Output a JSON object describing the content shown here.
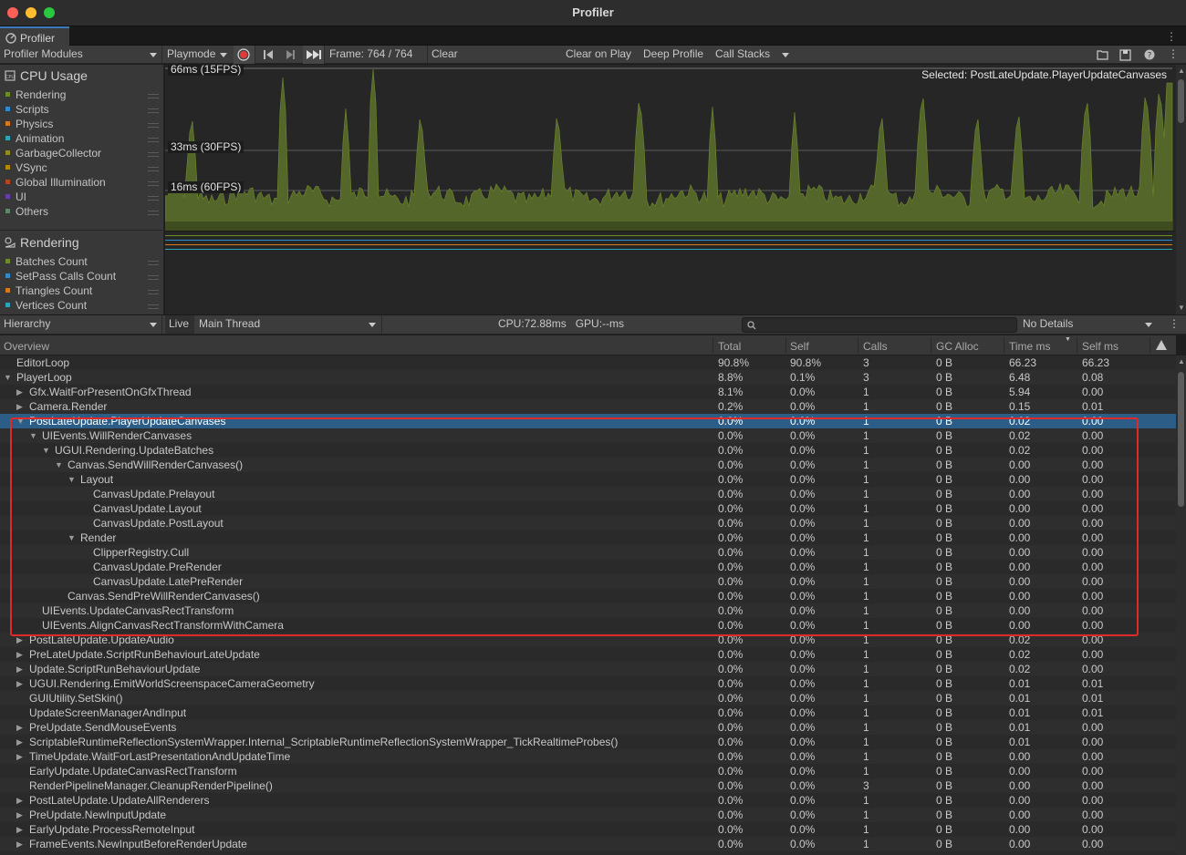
{
  "window": {
    "title": "Profiler"
  },
  "tab": {
    "label": "Profiler"
  },
  "toolbar": {
    "modules_label": "Profiler Modules",
    "playmode_label": "Playmode",
    "frame_label": "Frame: 764 / 764",
    "clear_label": "Clear",
    "clear_on_play_label": "Clear on Play",
    "deep_profile_label": "Deep Profile",
    "call_stacks_label": "Call Stacks"
  },
  "cpu_module": {
    "title": "CPU Usage",
    "legend": [
      {
        "label": "Rendering",
        "color": "#6b8e23"
      },
      {
        "label": "Scripts",
        "color": "#2e8bd0"
      },
      {
        "label": "Physics",
        "color": "#d87a1a"
      },
      {
        "label": "Animation",
        "color": "#2aa6b8"
      },
      {
        "label": "GarbageCollector",
        "color": "#9a8a1c"
      },
      {
        "label": "VSync",
        "color": "#b48a00"
      },
      {
        "label": "Global Illumination",
        "color": "#b8431f"
      },
      {
        "label": "UI",
        "color": "#6a3ca8"
      },
      {
        "label": "Others",
        "color": "#5a8a6a"
      }
    ]
  },
  "rendering_module": {
    "title": "Rendering",
    "legend": [
      {
        "label": "Batches Count",
        "color": "#6b8e23"
      },
      {
        "label": "SetPass Calls Count",
        "color": "#2e8bd0"
      },
      {
        "label": "Triangles Count",
        "color": "#d87a1a"
      },
      {
        "label": "Vertices Count",
        "color": "#2aa6b8"
      }
    ]
  },
  "chart": {
    "fps_66": "66ms (15FPS)",
    "fps_33": "33ms (30FPS)",
    "fps_16": "16ms (60FPS)",
    "selected": "Selected: PostLateUpdate.PlayerUpdateCanvases"
  },
  "hierarchy_toolbar": {
    "view_label": "Hierarchy",
    "live_label": "Live",
    "thread_label": "Main Thread",
    "stats": "CPU:72.88ms   GPU:--ms",
    "details_label": "No Details"
  },
  "table": {
    "headers": [
      "Overview",
      "Total",
      "Self",
      "Calls",
      "GC Alloc",
      "Time ms",
      "Self ms"
    ],
    "rows": [
      {
        "name": "EditorLoop",
        "indent": 0,
        "toggle": "",
        "total": "90.8%",
        "self": "90.8%",
        "calls": "3",
        "gc": "0 B",
        "time": "66.23",
        "selfms": "66.23"
      },
      {
        "name": "PlayerLoop",
        "indent": 0,
        "toggle": "▼",
        "total": "8.8%",
        "self": "0.1%",
        "calls": "3",
        "gc": "0 B",
        "time": "6.48",
        "selfms": "0.08"
      },
      {
        "name": "Gfx.WaitForPresentOnGfxThread",
        "indent": 1,
        "toggle": "▶",
        "total": "8.1%",
        "self": "0.0%",
        "calls": "1",
        "gc": "0 B",
        "time": "5.94",
        "selfms": "0.00"
      },
      {
        "name": "Camera.Render",
        "indent": 1,
        "toggle": "▶",
        "total": "0.2%",
        "self": "0.0%",
        "calls": "1",
        "gc": "0 B",
        "time": "0.15",
        "selfms": "0.01"
      },
      {
        "name": "PostLateUpdate.PlayerUpdateCanvases",
        "indent": 1,
        "toggle": "▼",
        "total": "0.0%",
        "self": "0.0%",
        "calls": "1",
        "gc": "0 B",
        "time": "0.02",
        "selfms": "0.00",
        "selected": true
      },
      {
        "name": "UIEvents.WillRenderCanvases",
        "indent": 2,
        "toggle": "▼",
        "total": "0.0%",
        "self": "0.0%",
        "calls": "1",
        "gc": "0 B",
        "time": "0.02",
        "selfms": "0.00"
      },
      {
        "name": "UGUI.Rendering.UpdateBatches",
        "indent": 3,
        "toggle": "▼",
        "total": "0.0%",
        "self": "0.0%",
        "calls": "1",
        "gc": "0 B",
        "time": "0.02",
        "selfms": "0.00"
      },
      {
        "name": "Canvas.SendWillRenderCanvases()",
        "indent": 4,
        "toggle": "▼",
        "total": "0.0%",
        "self": "0.0%",
        "calls": "1",
        "gc": "0 B",
        "time": "0.00",
        "selfms": "0.00"
      },
      {
        "name": "Layout",
        "indent": 5,
        "toggle": "▼",
        "total": "0.0%",
        "self": "0.0%",
        "calls": "1",
        "gc": "0 B",
        "time": "0.00",
        "selfms": "0.00"
      },
      {
        "name": "CanvasUpdate.Prelayout",
        "indent": 6,
        "toggle": "",
        "total": "0.0%",
        "self": "0.0%",
        "calls": "1",
        "gc": "0 B",
        "time": "0.00",
        "selfms": "0.00"
      },
      {
        "name": "CanvasUpdate.Layout",
        "indent": 6,
        "toggle": "",
        "total": "0.0%",
        "self": "0.0%",
        "calls": "1",
        "gc": "0 B",
        "time": "0.00",
        "selfms": "0.00"
      },
      {
        "name": "CanvasUpdate.PostLayout",
        "indent": 6,
        "toggle": "",
        "total": "0.0%",
        "self": "0.0%",
        "calls": "1",
        "gc": "0 B",
        "time": "0.00",
        "selfms": "0.00"
      },
      {
        "name": "Render",
        "indent": 5,
        "toggle": "▼",
        "total": "0.0%",
        "self": "0.0%",
        "calls": "1",
        "gc": "0 B",
        "time": "0.00",
        "selfms": "0.00"
      },
      {
        "name": "ClipperRegistry.Cull",
        "indent": 6,
        "toggle": "",
        "total": "0.0%",
        "self": "0.0%",
        "calls": "1",
        "gc": "0 B",
        "time": "0.00",
        "selfms": "0.00"
      },
      {
        "name": "CanvasUpdate.PreRender",
        "indent": 6,
        "toggle": "",
        "total": "0.0%",
        "self": "0.0%",
        "calls": "1",
        "gc": "0 B",
        "time": "0.00",
        "selfms": "0.00"
      },
      {
        "name": "CanvasUpdate.LatePreRender",
        "indent": 6,
        "toggle": "",
        "total": "0.0%",
        "self": "0.0%",
        "calls": "1",
        "gc": "0 B",
        "time": "0.00",
        "selfms": "0.00"
      },
      {
        "name": "Canvas.SendPreWillRenderCanvases()",
        "indent": 4,
        "toggle": "",
        "total": "0.0%",
        "self": "0.0%",
        "calls": "1",
        "gc": "0 B",
        "time": "0.00",
        "selfms": "0.00"
      },
      {
        "name": "UIEvents.UpdateCanvasRectTransform",
        "indent": 2,
        "toggle": "",
        "total": "0.0%",
        "self": "0.0%",
        "calls": "1",
        "gc": "0 B",
        "time": "0.00",
        "selfms": "0.00"
      },
      {
        "name": "UIEvents.AlignCanvasRectTransformWithCamera",
        "indent": 2,
        "toggle": "",
        "total": "0.0%",
        "self": "0.0%",
        "calls": "1",
        "gc": "0 B",
        "time": "0.00",
        "selfms": "0.00"
      },
      {
        "name": "PostLateUpdate.UpdateAudio",
        "indent": 1,
        "toggle": "▶",
        "total": "0.0%",
        "self": "0.0%",
        "calls": "1",
        "gc": "0 B",
        "time": "0.02",
        "selfms": "0.00"
      },
      {
        "name": "PreLateUpdate.ScriptRunBehaviourLateUpdate",
        "indent": 1,
        "toggle": "▶",
        "total": "0.0%",
        "self": "0.0%",
        "calls": "1",
        "gc": "0 B",
        "time": "0.02",
        "selfms": "0.00"
      },
      {
        "name": "Update.ScriptRunBehaviourUpdate",
        "indent": 1,
        "toggle": "▶",
        "total": "0.0%",
        "self": "0.0%",
        "calls": "1",
        "gc": "0 B",
        "time": "0.02",
        "selfms": "0.00"
      },
      {
        "name": "UGUI.Rendering.EmitWorldScreenspaceCameraGeometry",
        "indent": 1,
        "toggle": "▶",
        "total": "0.0%",
        "self": "0.0%",
        "calls": "1",
        "gc": "0 B",
        "time": "0.01",
        "selfms": "0.01"
      },
      {
        "name": "GUIUtility.SetSkin()",
        "indent": 1,
        "toggle": "",
        "total": "0.0%",
        "self": "0.0%",
        "calls": "1",
        "gc": "0 B",
        "time": "0.01",
        "selfms": "0.01"
      },
      {
        "name": "UpdateScreenManagerAndInput",
        "indent": 1,
        "toggle": "",
        "total": "0.0%",
        "self": "0.0%",
        "calls": "1",
        "gc": "0 B",
        "time": "0.01",
        "selfms": "0.01"
      },
      {
        "name": "PreUpdate.SendMouseEvents",
        "indent": 1,
        "toggle": "▶",
        "total": "0.0%",
        "self": "0.0%",
        "calls": "1",
        "gc": "0 B",
        "time": "0.01",
        "selfms": "0.00"
      },
      {
        "name": "ScriptableRuntimeReflectionSystemWrapper.Internal_ScriptableRuntimeReflectionSystemWrapper_TickRealtimeProbes()",
        "indent": 1,
        "toggle": "▶",
        "total": "0.0%",
        "self": "0.0%",
        "calls": "1",
        "gc": "0 B",
        "time": "0.01",
        "selfms": "0.00"
      },
      {
        "name": "TimeUpdate.WaitForLastPresentationAndUpdateTime",
        "indent": 1,
        "toggle": "▶",
        "total": "0.0%",
        "self": "0.0%",
        "calls": "1",
        "gc": "0 B",
        "time": "0.00",
        "selfms": "0.00"
      },
      {
        "name": "EarlyUpdate.UpdateCanvasRectTransform",
        "indent": 1,
        "toggle": "",
        "total": "0.0%",
        "self": "0.0%",
        "calls": "1",
        "gc": "0 B",
        "time": "0.00",
        "selfms": "0.00"
      },
      {
        "name": "RenderPipelineManager.CleanupRenderPipeline()",
        "indent": 1,
        "toggle": "",
        "total": "0.0%",
        "self": "0.0%",
        "calls": "3",
        "gc": "0 B",
        "time": "0.00",
        "selfms": "0.00"
      },
      {
        "name": "PostLateUpdate.UpdateAllRenderers",
        "indent": 1,
        "toggle": "▶",
        "total": "0.0%",
        "self": "0.0%",
        "calls": "1",
        "gc": "0 B",
        "time": "0.00",
        "selfms": "0.00"
      },
      {
        "name": "PreUpdate.NewInputUpdate",
        "indent": 1,
        "toggle": "▶",
        "total": "0.0%",
        "self": "0.0%",
        "calls": "1",
        "gc": "0 B",
        "time": "0.00",
        "selfms": "0.00"
      },
      {
        "name": "EarlyUpdate.ProcessRemoteInput",
        "indent": 1,
        "toggle": "▶",
        "total": "0.0%",
        "self": "0.0%",
        "calls": "1",
        "gc": "0 B",
        "time": "0.00",
        "selfms": "0.00"
      },
      {
        "name": "FrameEvents.NewInputBeforeRenderUpdate",
        "indent": 1,
        "toggle": "▶",
        "total": "0.0%",
        "self": "0.0%",
        "calls": "1",
        "gc": "0 B",
        "time": "0.00",
        "selfms": "0.00"
      }
    ]
  }
}
